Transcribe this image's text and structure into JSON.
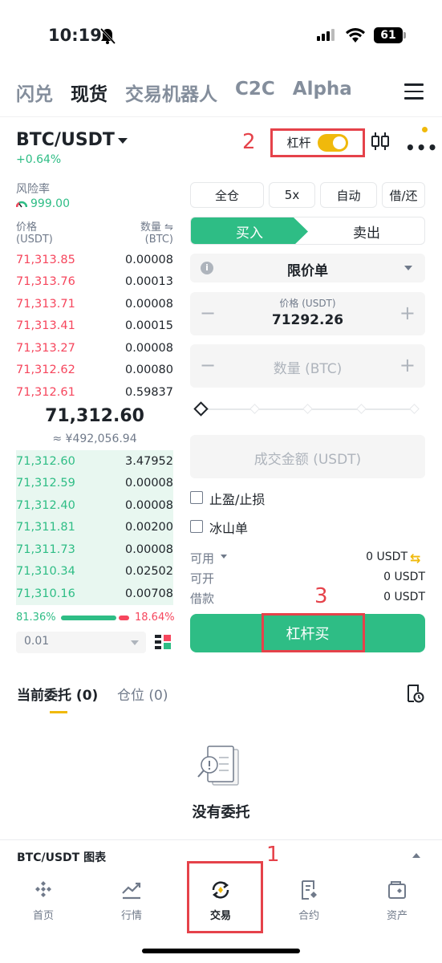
{
  "status": {
    "time": "10:19",
    "battery": "61"
  },
  "top_tabs": [
    "闪兑",
    "现货",
    "交易机器人",
    "C2C",
    "Alpha"
  ],
  "pair": {
    "name": "BTC/USDT",
    "change": "+0.64%"
  },
  "leverage_label": "杠杆",
  "annotations": {
    "a1": "1",
    "a2": "2",
    "a3": "3"
  },
  "risk": {
    "label": "风险率",
    "value": "999.00"
  },
  "orderbook": {
    "price_header": "价格",
    "price_unit": "(USDT)",
    "qty_header": "数量 ⇋",
    "qty_unit": "(BTC)",
    "asks": [
      {
        "price": "71,313.85",
        "qty": "0.00008"
      },
      {
        "price": "71,313.76",
        "qty": "0.00013"
      },
      {
        "price": "71,313.71",
        "qty": "0.00008"
      },
      {
        "price": "71,313.41",
        "qty": "0.00015"
      },
      {
        "price": "71,313.27",
        "qty": "0.00008"
      },
      {
        "price": "71,312.62",
        "qty": "0.00080"
      },
      {
        "price": "71,312.61",
        "qty": "0.59837"
      }
    ],
    "mid_price": "71,312.60",
    "mid_fiat": "≈ ¥492,056.94",
    "bids": [
      {
        "price": "71,312.60",
        "qty": "3.47952"
      },
      {
        "price": "71,312.59",
        "qty": "0.00008"
      },
      {
        "price": "71,312.40",
        "qty": "0.00008"
      },
      {
        "price": "71,311.81",
        "qty": "0.00200"
      },
      {
        "price": "71,311.73",
        "qty": "0.00008"
      },
      {
        "price": "71,310.34",
        "qty": "0.02502"
      },
      {
        "price": "71,310.16",
        "qty": "0.00708"
      }
    ],
    "buy_ratio": "81.36%",
    "sell_ratio": "18.64%",
    "precision": "0.01"
  },
  "form": {
    "margin_mode": "全仓",
    "leverage": "5x",
    "auto": "自动",
    "borrow_repay": "借/还",
    "buy_tab": "买入",
    "sell_tab": "卖出",
    "order_type": "限价单",
    "price_label": "价格 (USDT)",
    "price_value": "71292.26",
    "qty_placeholder": "数量 (BTC)",
    "total_placeholder": "成交金额 (USDT)",
    "tp_sl": "止盈/止损",
    "iceberg": "冰山单",
    "available_label": "可用",
    "available_value": "0 USDT",
    "openable_label": "可开",
    "openable_value": "0 USDT",
    "borrowed_label": "借款",
    "borrowed_value": "0 USDT",
    "action": "杠杆买"
  },
  "orders": {
    "tab_open": "当前委托 (0)",
    "tab_positions": "仓位 (0)",
    "empty": "没有委托"
  },
  "chart_bar": "BTC/USDT 图表",
  "nav": [
    "首页",
    "行情",
    "交易",
    "合约",
    "资产"
  ],
  "colors": {
    "buy": "#2ebd85",
    "sell": "#f6465d",
    "accent": "#f0b90b",
    "annotation": "#e5424a"
  }
}
